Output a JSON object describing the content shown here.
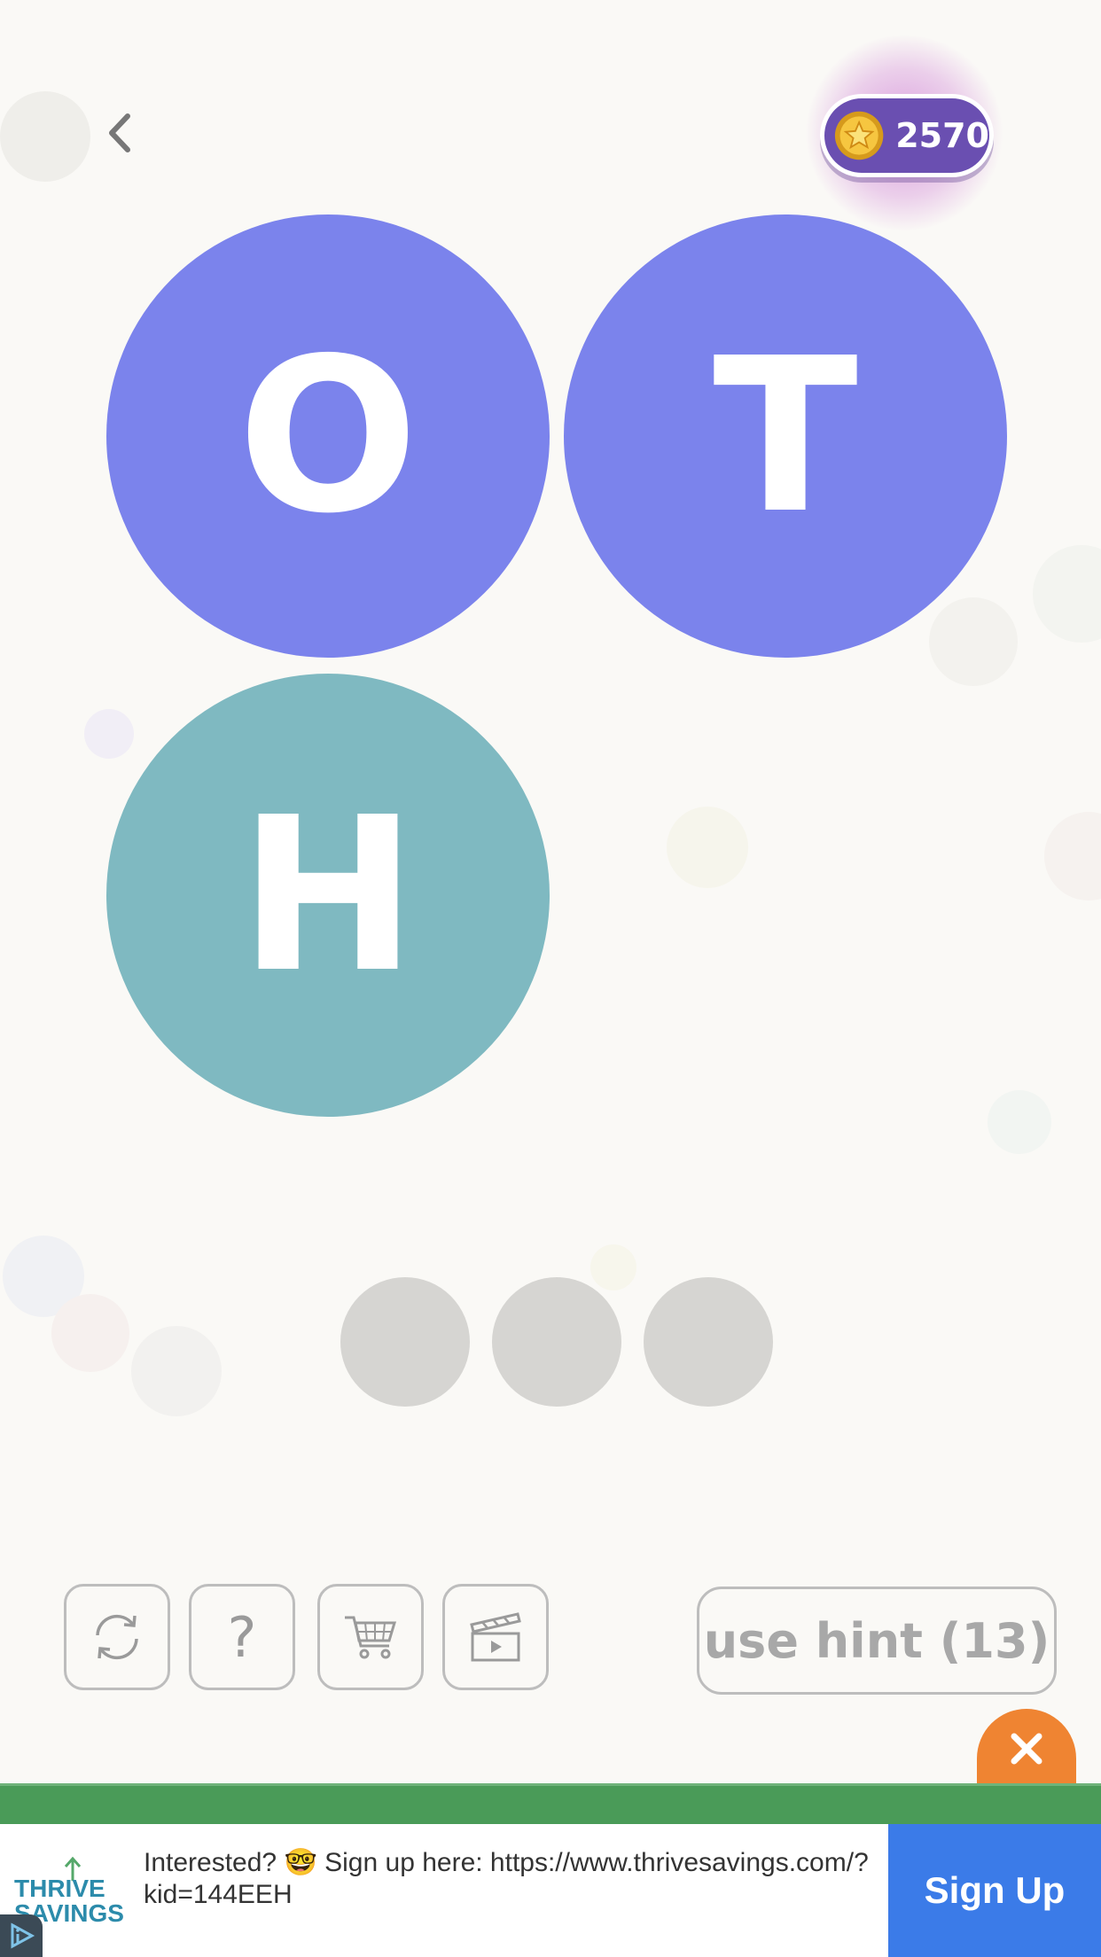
{
  "colors": {
    "background": "#faf9f6",
    "tile_purple": "#7b83ec",
    "tile_teal": "#7fb9c1",
    "slot_gray": "#d6d5d2",
    "coin_pill": "#6a4fb1",
    "ad_cta": "#3b7be8",
    "ad_close": "#ef8432",
    "ad_bar": "#4a9b58"
  },
  "header": {
    "back_icon": "chevron-left-icon",
    "coins": "2570",
    "coin_icon": "gold-star-coin-icon"
  },
  "board": {
    "tiles": [
      {
        "letter": "O",
        "color": "#7b83ec"
      },
      {
        "letter": "T",
        "color": "#7b83ec"
      },
      {
        "letter": "H",
        "color": "#7fb9c1"
      }
    ],
    "answer_slots": [
      "",
      "",
      ""
    ]
  },
  "toolbar": {
    "tools": [
      {
        "name": "shuffle",
        "icon": "refresh-arrows-icon"
      },
      {
        "name": "help",
        "icon": "question-mark-icon",
        "glyph": "?"
      },
      {
        "name": "shop",
        "icon": "shopping-cart-icon"
      },
      {
        "name": "video",
        "icon": "clapperboard-icon"
      }
    ],
    "hint_label": "use hint (13)"
  },
  "ad": {
    "close_icon": "close-x-icon",
    "brand": "THRIVE SAVINGS",
    "text": "Interested? 🤓 Sign up here: https://www.thrivesavings.com/?kid=144EEH",
    "cta": "Sign Up",
    "ad_choices_icon": "ad-choices-icon"
  }
}
